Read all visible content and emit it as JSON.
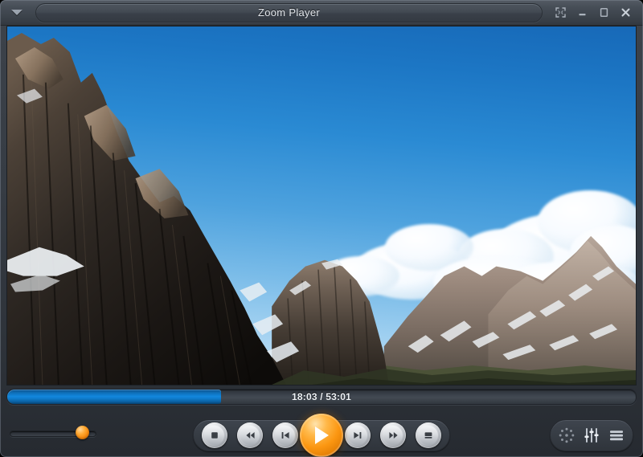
{
  "window": {
    "title": "Zoom Player",
    "menu_icon": "chevron-down-icon",
    "controls": [
      {
        "name": "fullscreen-button",
        "icon": "fullscreen-expand-icon",
        "label": "Fullscreen"
      },
      {
        "name": "minimize-button",
        "icon": "minimize-icon",
        "label": "Minimize"
      },
      {
        "name": "maximize-button",
        "icon": "maximize-icon",
        "label": "Maximize"
      },
      {
        "name": "close-button",
        "icon": "close-x-icon",
        "label": "Close"
      }
    ]
  },
  "video": {
    "alt": "Mountain landscape with rocky dolomite cliffs, snow patches and cumulus clouds under blue sky",
    "sky_color": "#2a8ad3",
    "rock_dark": "#2b2520",
    "rock_light": "#9c8a79",
    "snow_color": "#f2f4f6"
  },
  "seek": {
    "current_time": "18:03",
    "total_time": "53:01",
    "time_display": "18:03 / 53:01",
    "progress_percent": 34,
    "fill_color": "#1287dd"
  },
  "volume": {
    "level_percent": 84,
    "knob_color": "#f58b10"
  },
  "transport": [
    {
      "name": "stop-button",
      "icon": "stop-icon",
      "label": "Stop"
    },
    {
      "name": "rewind-button",
      "icon": "rewind-icon",
      "label": "Rewind"
    },
    {
      "name": "previous-button",
      "icon": "previous-track-icon",
      "label": "Previous"
    },
    {
      "name": "play-button",
      "icon": "play-icon",
      "label": "Play"
    },
    {
      "name": "next-button",
      "icon": "next-track-icon",
      "label": "Next"
    },
    {
      "name": "fast-forward-button",
      "icon": "fast-forward-icon",
      "label": "Fast Forward"
    },
    {
      "name": "eject-button",
      "icon": "eject-icon",
      "label": "Eject"
    }
  ],
  "right_controls": [
    {
      "name": "navigation-wheel-button",
      "icon": "navigation-dots-wheel-icon",
      "label": "Navigation"
    },
    {
      "name": "equalizer-button",
      "icon": "equalizer-sliders-icon",
      "label": "Equalizer"
    },
    {
      "name": "menu-button",
      "icon": "hamburger-menu-icon",
      "label": "Menu"
    }
  ]
}
